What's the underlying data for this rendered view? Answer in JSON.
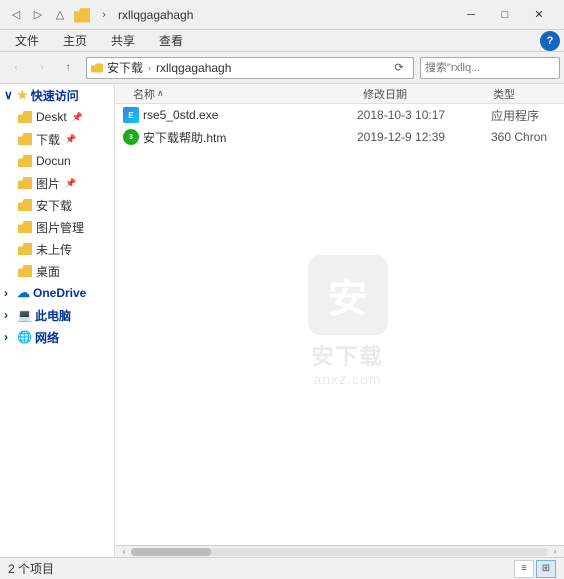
{
  "titleBar": {
    "folderName": "rxllqgagahagh",
    "minBtn": "─",
    "maxBtn": "□",
    "closeBtn": "✕"
  },
  "ribbonMenu": {
    "tabs": [
      "文件",
      "主页",
      "共享",
      "查看"
    ],
    "helpLabel": "?"
  },
  "navBar": {
    "backBtn": "‹",
    "forwardBtn": "›",
    "upBtn": "↑",
    "addressParts": [
      "安下载",
      "›",
      "rxllqgagahagh"
    ],
    "refreshBtn": "⟳",
    "searchPlaceholder": "搜索\"rxllq...",
    "searchIcon": "🔍"
  },
  "sidebar": {
    "quickAccess": "快速访问",
    "items": [
      {
        "label": "Deskt",
        "pinned": true
      },
      {
        "label": "下载",
        "pinned": true
      },
      {
        "label": "Docun",
        "pinned": false
      },
      {
        "label": "图片",
        "pinned": true
      },
      {
        "label": "安下载",
        "pinned": false
      },
      {
        "label": "图片管理",
        "pinned": false
      },
      {
        "label": "未上传",
        "pinned": false
      },
      {
        "label": "桌面",
        "pinned": false
      }
    ],
    "oneDrive": "OneDrive",
    "thisPC": "此电脑",
    "network": "网络"
  },
  "contentHeader": {
    "sortArrow": "∧",
    "colName": "名称",
    "colDate": "修改日期",
    "colType": "类型"
  },
  "files": [
    {
      "name": "rse5_0std.exe",
      "date": "2018-10-3  10:17",
      "type": "应用程序",
      "iconType": "exe"
    },
    {
      "name": "安下载帮助.htm",
      "date": "2019-12-9  12:39",
      "type": "360 Chron",
      "iconType": "360"
    }
  ],
  "watermark": {
    "logoText": "安",
    "mainText": "安下载",
    "url": "anxz.com"
  },
  "statusBar": {
    "itemCount": "2 个项目",
    "viewGrid": "⊞",
    "viewList": "≡"
  }
}
